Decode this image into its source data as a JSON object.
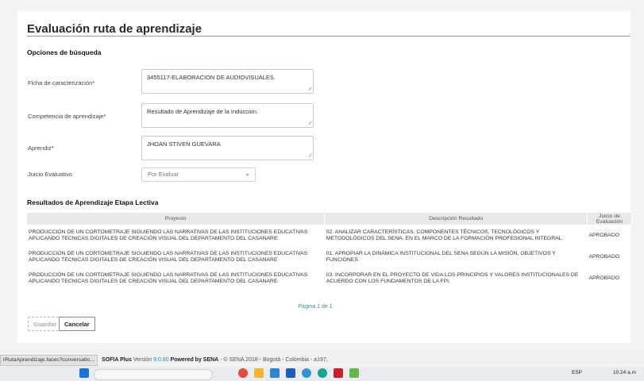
{
  "title": "Evaluación ruta de aprendizaje",
  "search": {
    "heading": "Opciones de búsqueda",
    "ficha_label": "Ficha de caracterización*",
    "ficha_value": "3455117-ELABORACION DE AUDIOVISUALES.",
    "competencia_label": "Competencia de aprendizaje*",
    "competencia_value": "Resultado de Aprendizaje de la Induccion.",
    "aprendiz_label": "Aprendiz*",
    "aprendiz_value": "JHOAN STIVEN GUEVARA",
    "juicio_label": "Juicio Evaluativo",
    "juicio_selected": "Por Evaluar"
  },
  "results": {
    "heading": "Resultados de Aprendizaje Etapa Lectiva",
    "columns": [
      "Proyecto",
      "Descripción Resultado",
      "Juicio de Evaluación"
    ],
    "rows": [
      {
        "proyecto": "PRODUCCIÓN DE UN CORTOMETRAJE SIGUIENDO LAS NARRATIVAS DE LAS INSTITUCIONES EDUCATIVAS APLICANDO TECNICAS DIGITALES DE CREACIÓN VISUAL DEL DEPARTAMENTO DEL CASANARE",
        "descripcion": "02. ANALIZAR CARACTERÍSTICAS, COMPONENTES TÉCNICOS, TECNOLÓGICOS Y METODOLÓGICOS DEL SENA, EN EL MARCO DE LA FORMACIÓN PROFESIONAL INTEGRAL.",
        "juicio": "APROBADO"
      },
      {
        "proyecto": "PRODUCCIÓN DE UN CORTOMETRAJE SIGUIENDO LAS NARRATIVAS DE LAS INSTITUCIONES EDUCATIVAS APLICANDO TECNICAS DIGITALES DE CREACIÓN VISUAL DEL DEPARTAMENTO DEL CASANARE",
        "descripcion": "01. APROPIAR LA DINÁMICA INSTITUCIONAL DEL SENA SEGÚN LA MISIÓN, OBJETIVOS Y FUNCIONES.",
        "juicio": "APROBADO"
      },
      {
        "proyecto": "PRODUCCIÓN DE UN CORTOMETRAJE SIGUIENDO LAS NARRATIVAS DE LAS INSTITUCIONES EDUCATIVAS APLICANDO TECNICAS DIGITALES DE CREACIÓN VISUAL DEL DEPARTAMENTO DEL CASANARE",
        "descripcion": "03. INCORPORAR EN EL PROYECTO DE VIDA LOS PRINCIPIOS Y VALORES INSTITUCIONALES DE ACUERDO CON LOS FUNDAMENTOS DE LA FPI.",
        "juicio": "APROBADO"
      }
    ],
    "pager": "Página 1 de 1"
  },
  "buttons": {
    "guardar": "Guardar",
    "cancelar": "Cancelar"
  },
  "footer": {
    "status_url": "rRutaAprendizaje.faces?conversatio...",
    "brand_prefix": "SOFIA Plus",
    "version_label": "Versión",
    "version": "9.0.80",
    "powered": "Powered by SENA",
    "rest": "- © SENA 2018 - Bogotá - Colombia - a197;"
  },
  "taskbar": {
    "lang": "ESP",
    "time": "10:24 a.m"
  },
  "colors": {
    "link": "#2b8fb3",
    "pager": "#3a8f8f"
  }
}
